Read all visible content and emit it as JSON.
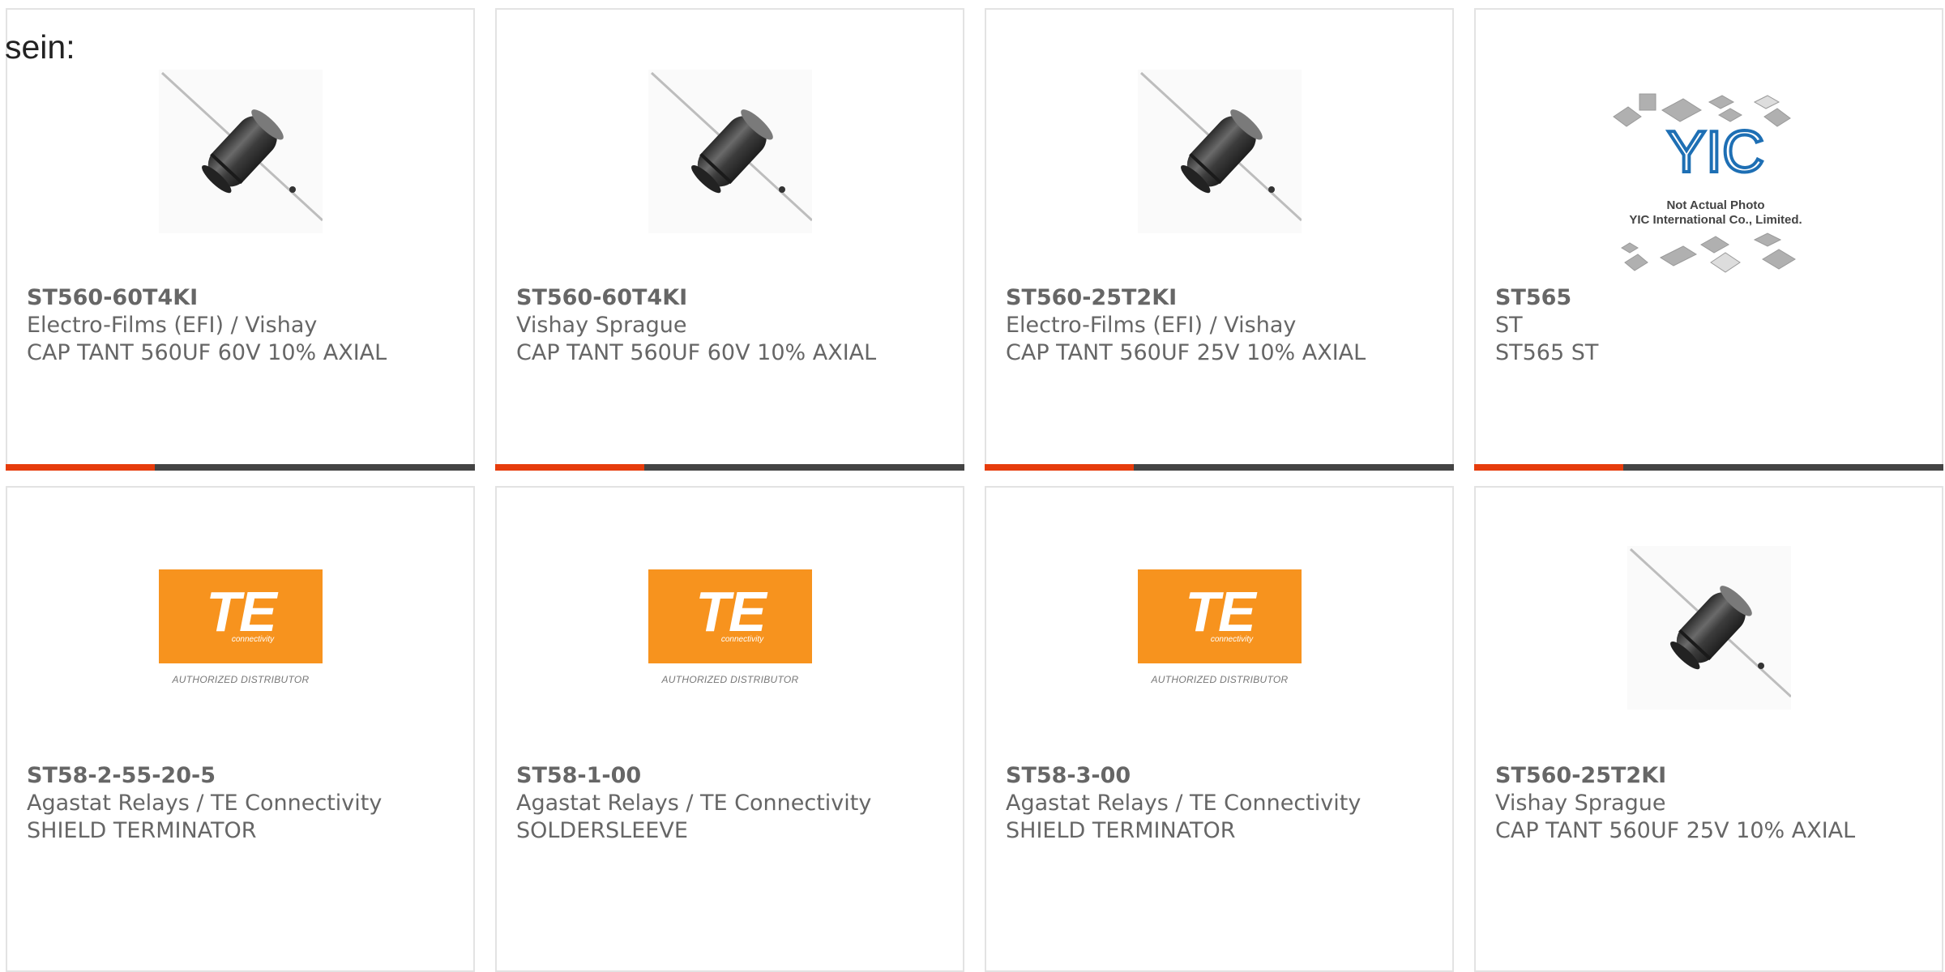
{
  "intro_text": "sein:",
  "colors": {
    "accent_bar": "#e63c0c",
    "bar": "#444444",
    "card_border": "#e3e3e3",
    "text": "#666666",
    "te_orange": "#f7931e"
  },
  "te_logo": {
    "word": "TE",
    "sub": "connectivity",
    "caption": "AUTHORIZED DISTRIBUTOR"
  },
  "yic_placeholder": {
    "line1": "Not Actual Photo",
    "line2": "YIC International Co., Limited.",
    "logo_text": "YIC"
  },
  "products": [
    {
      "part": "ST560-60T4KI",
      "manufacturer": "Electro-Films (EFI) / Vishay",
      "description": "CAP TANT 560UF 60V 10% AXIAL",
      "image": "axial-capacitor-image"
    },
    {
      "part": "ST560-60T4KI",
      "manufacturer": "Vishay Sprague",
      "description": "CAP TANT 560UF 60V 10% AXIAL",
      "image": "axial-capacitor-image"
    },
    {
      "part": "ST560-25T2KI",
      "manufacturer": "Electro-Films (EFI) / Vishay",
      "description": "CAP TANT 560UF 25V 10% AXIAL",
      "image": "axial-capacitor-image"
    },
    {
      "part": "ST565",
      "manufacturer": "ST",
      "description": "ST565 ST",
      "image": "yic-placeholder-image"
    },
    {
      "part": "ST58-2-55-20-5",
      "manufacturer": "Agastat Relays / TE Connectivity",
      "description": "SHIELD TERMINATOR",
      "image": "te-connectivity-logo"
    },
    {
      "part": "ST58-1-00",
      "manufacturer": "Agastat Relays / TE Connectivity",
      "description": "SOLDERSLEEVE",
      "image": "te-connectivity-logo"
    },
    {
      "part": "ST58-3-00",
      "manufacturer": "Agastat Relays / TE Connectivity",
      "description": "SHIELD TERMINATOR",
      "image": "te-connectivity-logo"
    },
    {
      "part": "ST560-25T2KI",
      "manufacturer": "Vishay Sprague",
      "description": "CAP TANT 560UF 25V 10% AXIAL",
      "image": "axial-capacitor-image"
    }
  ]
}
